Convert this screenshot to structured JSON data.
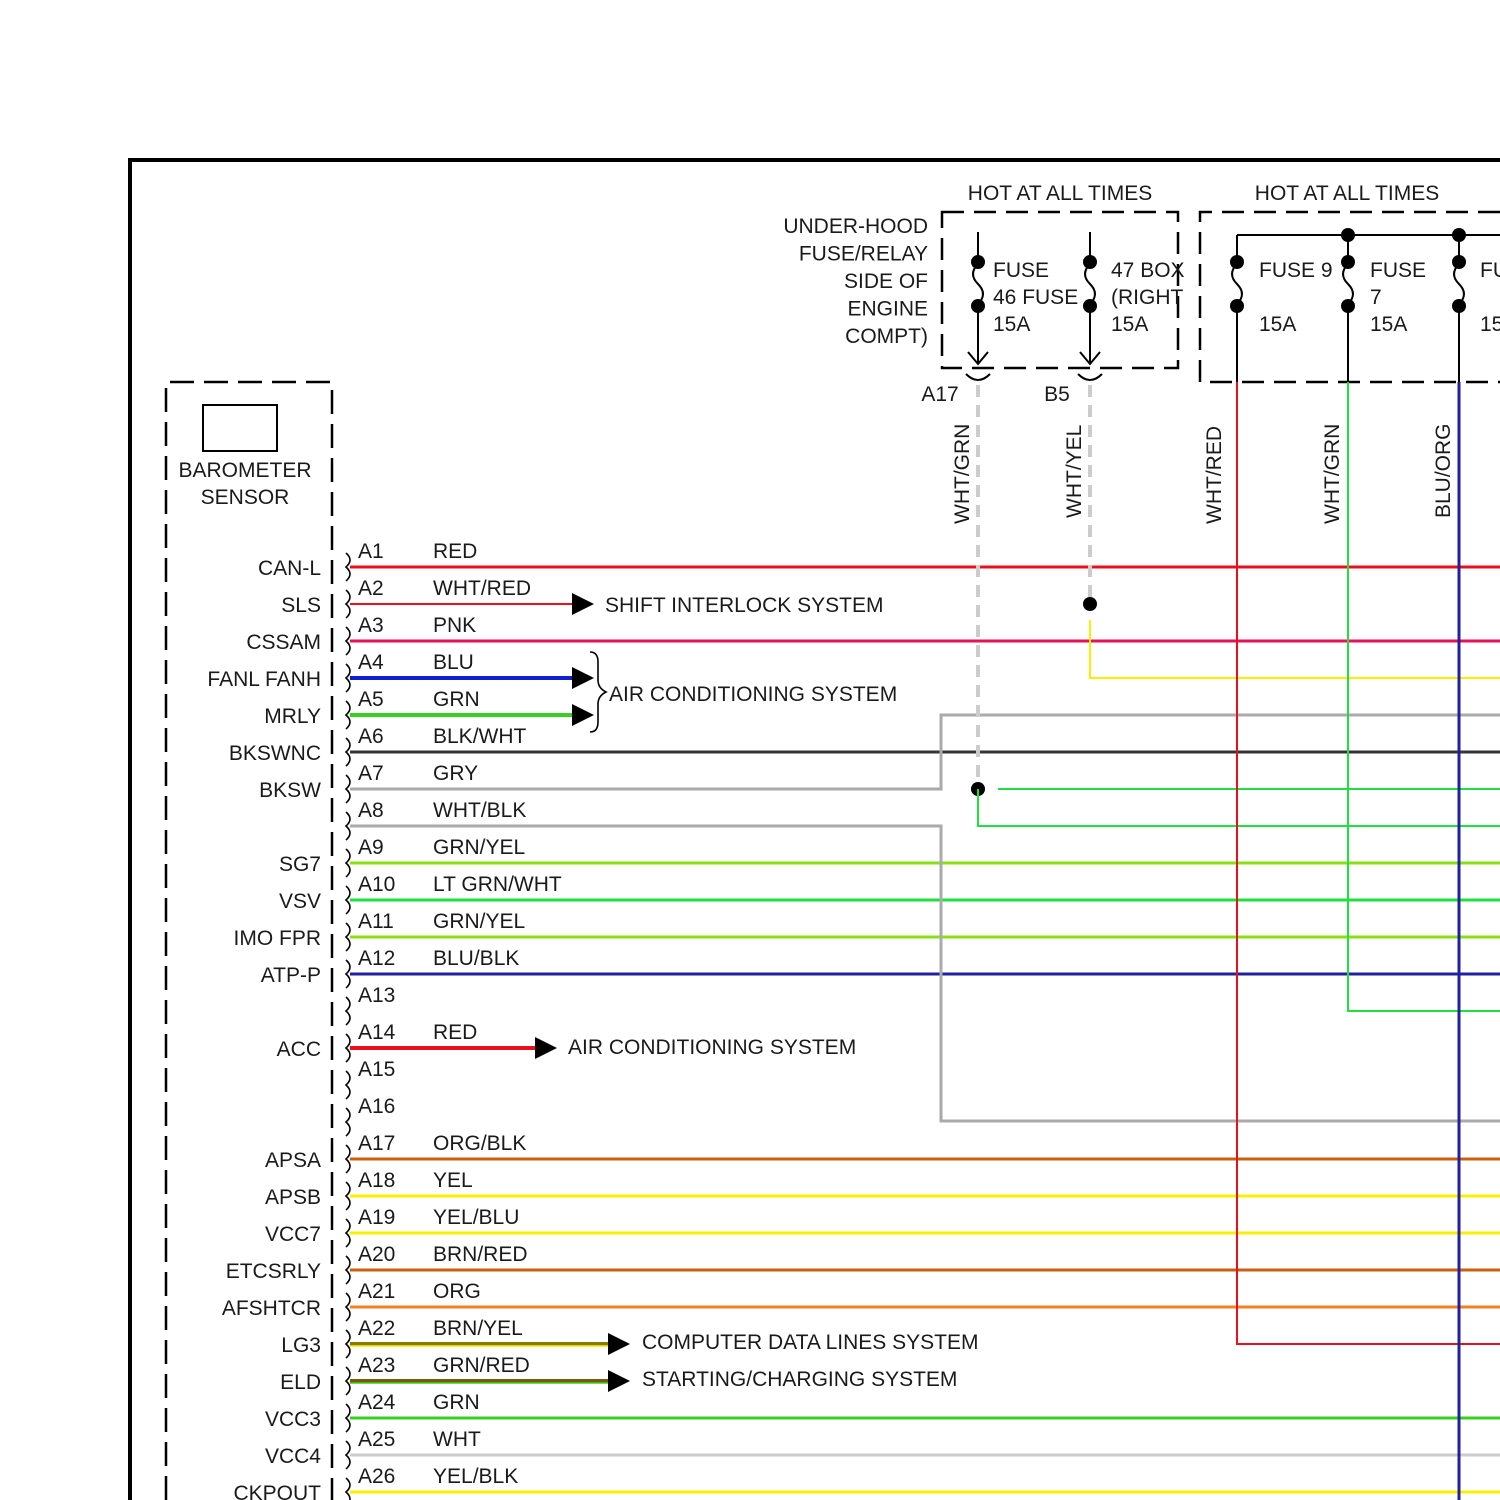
{
  "fuse_block": {
    "hot_label": "HOT AT ALL TIMES",
    "location_lines": [
      "UNDER-HOOD",
      "FUSE/RELAY",
      "SIDE OF",
      "ENGINE",
      "COMPT)"
    ],
    "fuse46_lines": [
      "FUSE",
      "46",
      "15A"
    ],
    "fuse47_lines": [
      "47",
      "(RIGHT",
      "15A"
    ],
    "box_word": "BOX",
    "fuse_word": "FUSE",
    "connectors": [
      "A17",
      "B5"
    ],
    "wires": [
      "WHT/GRN",
      "WHT/YEL"
    ]
  },
  "fuse_block_2": {
    "hot_label": "HOT AT ALL TIMES",
    "fuse9_lines": [
      "FUSE 9",
      "15A"
    ],
    "fuse7_lines": [
      "FUSE",
      "7",
      "15A"
    ],
    "fuse3_lines": [
      "FU",
      "15"
    ],
    "wires": [
      "WHT/RED",
      "WHT/GRN",
      "BLU/ORG"
    ]
  },
  "module": {
    "name_lines": [
      "BAROMETER",
      "SENSOR"
    ]
  },
  "pins": [
    {
      "pin": "A1",
      "signal": "CAN-L",
      "wire": "RED"
    },
    {
      "pin": "A2",
      "signal": "SLS",
      "wire": "WHT/RED"
    },
    {
      "pin": "A3",
      "signal": "CSSAM",
      "wire": "PNK"
    },
    {
      "pin": "A4",
      "signal": "FANL FANH",
      "wire": "BLU"
    },
    {
      "pin": "A5",
      "signal": "MRLY",
      "wire": "GRN"
    },
    {
      "pin": "A6",
      "signal": "BKSWNC",
      "wire": "BLK/WHT"
    },
    {
      "pin": "A7",
      "signal": "BKSW",
      "wire": "GRY"
    },
    {
      "pin": "A8",
      "signal": "",
      "wire": "WHT/BLK"
    },
    {
      "pin": "A9",
      "signal": "SG7",
      "wire": "GRN/YEL"
    },
    {
      "pin": "A10",
      "signal": "VSV",
      "wire": "LT GRN/WHT"
    },
    {
      "pin": "A11",
      "signal": "IMO FPR",
      "wire": "GRN/YEL"
    },
    {
      "pin": "A12",
      "signal": "ATP-P",
      "wire": "BLU/BLK"
    },
    {
      "pin": "A13",
      "signal": "",
      "wire": ""
    },
    {
      "pin": "A14",
      "signal": "ACC",
      "wire": "RED"
    },
    {
      "pin": "A15",
      "signal": "",
      "wire": ""
    },
    {
      "pin": "A16",
      "signal": "",
      "wire": ""
    },
    {
      "pin": "A17",
      "signal": "APSA",
      "wire": "ORG/BLK"
    },
    {
      "pin": "A18",
      "signal": "APSB",
      "wire": "YEL"
    },
    {
      "pin": "A19",
      "signal": "VCC7",
      "wire": "YEL/BLU"
    },
    {
      "pin": "A20",
      "signal": "ETCSRLY",
      "wire": "BRN/RED"
    },
    {
      "pin": "A21",
      "signal": "AFSHTCR",
      "wire": "ORG"
    },
    {
      "pin": "A22",
      "signal": "LG3",
      "wire": "BRN/YEL"
    },
    {
      "pin": "A23",
      "signal": "ELD",
      "wire": "GRN/RED"
    },
    {
      "pin": "A24",
      "signal": "VCC3",
      "wire": "GRN"
    },
    {
      "pin": "A25",
      "signal": "VCC4",
      "wire": "WHT"
    },
    {
      "pin": "A26",
      "signal": "CKPOUT",
      "wire": "YEL/BLK"
    }
  ],
  "destinations": {
    "shift_interlock": "SHIFT INTERLOCK SYSTEM",
    "air_conditioning_1": "AIR CONDITIONING SYSTEM",
    "air_conditioning_2": "AIR CONDITIONING SYSTEM",
    "computer_data": "COMPUTER DATA LINES SYSTEM",
    "starting_charging": "STARTING/CHARGING SYSTEM"
  },
  "colors": {
    "frame": "#000000",
    "red": "#e8101c",
    "pink": "#e8105a",
    "blue": "#1020d0",
    "green": "#38d020",
    "yellow_green": "#88e010",
    "lt_green": "#20e040",
    "gray": "#aaaaaa",
    "dark": "#333333",
    "orange": "#f08020",
    "brown_orange": "#c86010",
    "yellow": "#f8f000",
    "navy": "#2020a0"
  }
}
